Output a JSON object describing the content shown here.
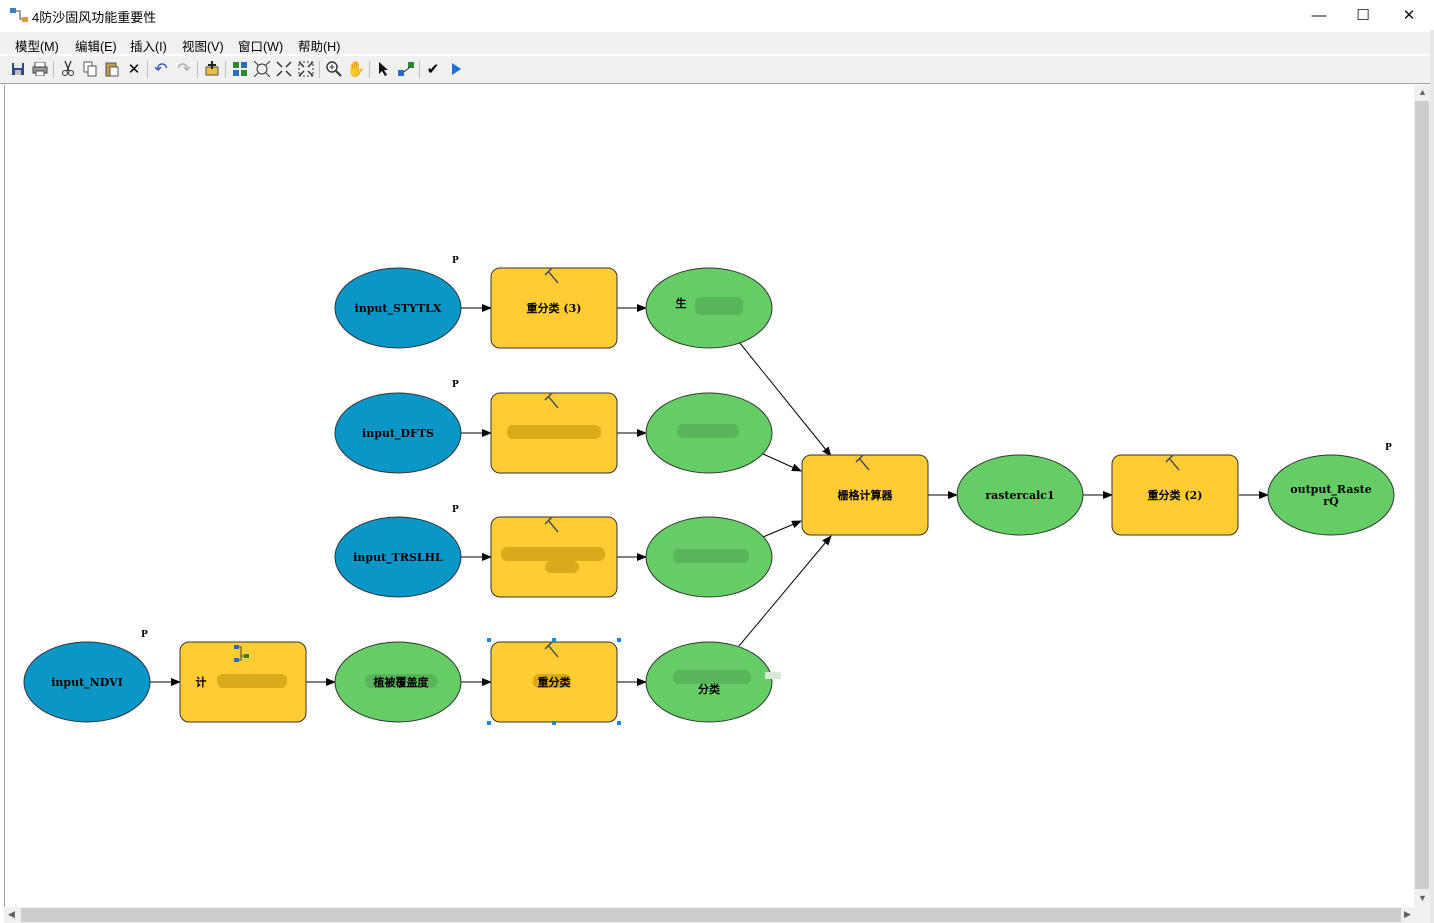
{
  "window": {
    "title": "4防沙固风功能重要性",
    "minimize": "—",
    "maximize": "☐",
    "close": "✕"
  },
  "menu": [
    {
      "label": "模型(M)"
    },
    {
      "label": "编辑(E)"
    },
    {
      "label": "插入(I)"
    },
    {
      "label": "视图(V)"
    },
    {
      "label": "窗口(W)"
    },
    {
      "label": "帮助(H)"
    }
  ],
  "toolbar": {
    "icons": [
      "save-icon",
      "print-icon",
      "cut-icon",
      "copy-icon",
      "paste-icon",
      "delete-icon",
      "undo-icon",
      "redo-icon",
      "add-data-icon",
      "auto-layout-icon",
      "full-extent-icon",
      "zoom-in-fixed-icon",
      "zoom-out-fixed-icon",
      "zoom-in-icon",
      "pan-icon",
      "select-icon",
      "connect-icon",
      "validate-icon",
      "run-icon"
    ]
  },
  "model": {
    "param_marker": "P",
    "nodes": {
      "input_styl": "input_STYTLX",
      "input_dfts": "input_DFTS",
      "input_trslhl": "input_TRSLHL",
      "input_ndvi": "input_NDVI",
      "reclass3": "重分类 (3)",
      "reclass_dfts": "",
      "reclass_trslhl": "",
      "calc_veg": "计",
      "reclass_veg": "重分类",
      "out_styl": "生",
      "out_dfts": "",
      "out_trslhl": "",
      "out_veg": "植被覆盖度",
      "out_veg_reclass": "分类",
      "raster_calc": "栅格计算器",
      "rastercalc1": "rastercalc1",
      "reclass2": "重分类 (2)",
      "output": "output_RasterQ"
    }
  },
  "colors": {
    "input": "#0b96c8",
    "tool": "#ffcc33",
    "derived": "#66cc66"
  }
}
